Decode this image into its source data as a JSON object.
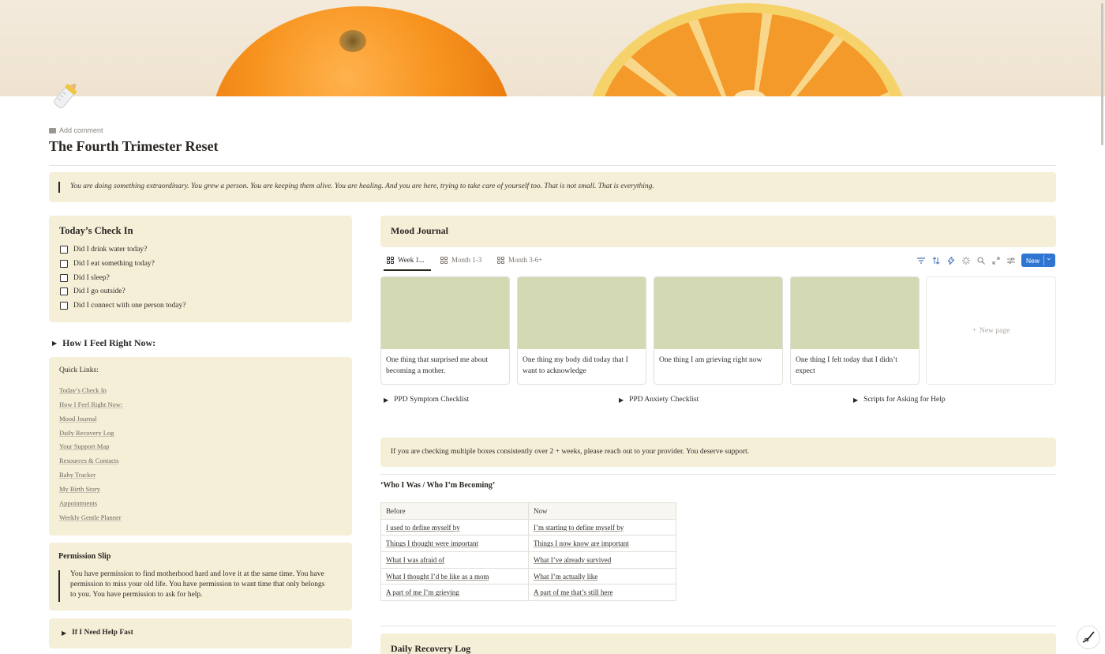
{
  "page": {
    "add_comment": "Add comment",
    "title": "The Fourth Trimester Reset",
    "quote": "You are doing something extraordinary. You grew a person. You are keeping them alive. You are healing. And you are here, trying to take care of yourself too. That is not small. That is everything.",
    "icon": "baby-bottle-icon",
    "cover": "orange-photo"
  },
  "checkin": {
    "title": "Today’s Check In",
    "items": [
      "Did I drink water today?",
      "Did I eat something today?",
      "Did I sleep?",
      "Did I go outside?",
      "Did I connect with one person today?"
    ]
  },
  "feel_toggle": "How I Feel Right Now:",
  "quick_links": {
    "title": "Quick Links:",
    "items": [
      "Today’s Check In",
      "How I Feel Right Now:",
      "Mood Journal",
      "Daily Recovery Log",
      "Your Support Map",
      "Resources & Contacts",
      "Baby Tracker",
      "My Birth Story",
      "Appointments",
      "Weekly Gentle Planner"
    ]
  },
  "permission": {
    "title": "Permission Slip",
    "text": "You have permission to find motherhood hard and love it at the same time. You have permission to miss your old life. You have permission to want time that only belongs to you. You have permission to ask for help."
  },
  "help_fast": "If I Need Help Fast",
  "mood": {
    "title": "Mood Journal",
    "tabs": [
      "Week 1...",
      "Month 1-3",
      "Month 3-6+"
    ],
    "new_button": "New",
    "cards": [
      "One thing that surprised me about becoming a mother.",
      "One thing my body did today that I want to acknowledge",
      "One thing I am grieving right now",
      "One thing I felt today that I didn’t expect"
    ],
    "new_page": "New page",
    "toggles": [
      "PPD Symptom Checklist",
      "PPD Anxiety Checklist",
      "Scripts for Asking for Help"
    ]
  },
  "info_callout": "If you are checking multiple boxes consistently over 2 + weeks, please reach out to your provider. You deserve support.",
  "who": {
    "heading": "‘Who I Was / Who I’m Becoming’",
    "headers": [
      "Before",
      "Now"
    ],
    "rows": [
      [
        "I used to define myself by",
        "I’m starting to define myself by"
      ],
      [
        "Things I thought were important",
        "Things I now know are important"
      ],
      [
        "What I was afraid of",
        "What I’ve already survived"
      ],
      [
        "What I thought I’d be like as a mom",
        "What I’m actually like"
      ],
      [
        "A part of me I’m grieving",
        "A part of me that’s still here"
      ]
    ]
  },
  "recovery": {
    "title": "Daily Recovery Log"
  },
  "colors": {
    "callout_bg": "#f5efd8",
    "card_cover": "#d3d9b3",
    "accent_blue": "#2f76d2"
  }
}
